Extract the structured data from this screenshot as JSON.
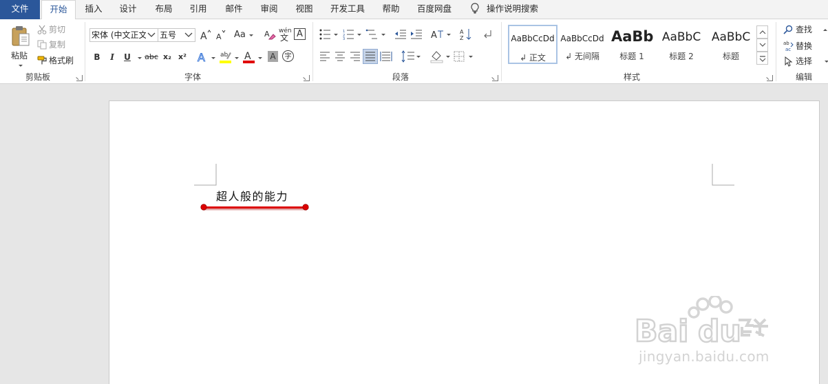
{
  "tabs": {
    "file": "文件",
    "home": "开始",
    "insert": "插入",
    "design": "设计",
    "layout": "布局",
    "references": "引用",
    "mailings": "邮件",
    "review": "审阅",
    "view": "视图",
    "developer": "开发工具",
    "help": "帮助",
    "baidu": "百度网盘",
    "tellme": "操作说明搜索"
  },
  "clipboard": {
    "paste": "粘贴",
    "cut": "剪切",
    "copy": "复制",
    "format_painter": "格式刷",
    "label": "剪贴板"
  },
  "font": {
    "name": "宋体 (中文正文)",
    "size": "五号",
    "case_button": "Aa",
    "phonetic_top": "wén",
    "phonetic_bottom": "文",
    "border_char": "A",
    "bold": "B",
    "italic": "I",
    "underline": "U",
    "strike": "abc",
    "subscript": "x₂",
    "superscript": "x²",
    "enclose_char": "字",
    "label": "字体"
  },
  "paragraph": {
    "label": "段落"
  },
  "styles": {
    "items": [
      {
        "preview": "AaBbCcDd",
        "name": "↲ 正文"
      },
      {
        "preview": "AaBbCcDd",
        "name": "↲ 无间隔"
      },
      {
        "preview": "AaBb",
        "name": "标题 1"
      },
      {
        "preview": "AaBbC",
        "name": "标题 2"
      },
      {
        "preview": "AaBbC",
        "name": "标题"
      }
    ],
    "label": "样式"
  },
  "editing": {
    "find": "查找",
    "replace": "替换",
    "select": "选择",
    "label": "编辑"
  },
  "document": {
    "text": "超人般的能力"
  },
  "watermark": {
    "url": "jingyan.baidu.com"
  },
  "colors": {
    "accent": "#2b579a",
    "highlight": "#ffff00",
    "font_color": "#e00000",
    "annotation": "#dd0000"
  }
}
